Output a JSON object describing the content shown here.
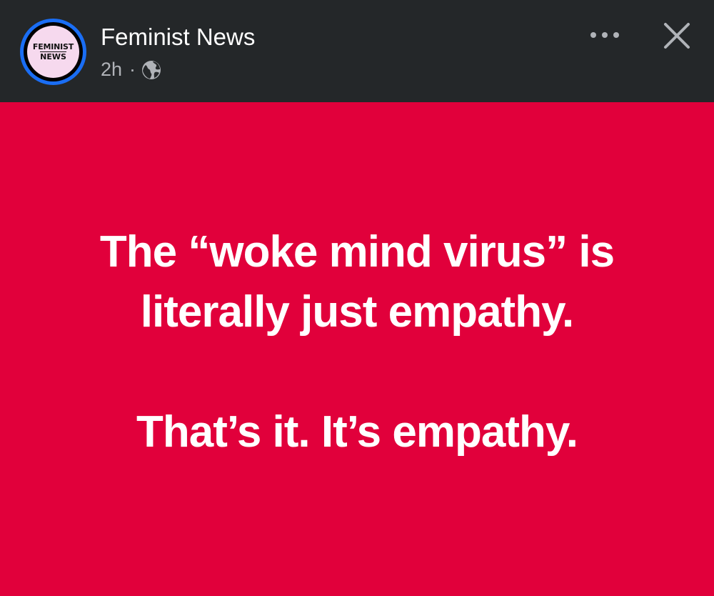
{
  "header": {
    "page_name": "Feminist News",
    "time_ago": "2h",
    "separator": "·",
    "audience_icon": "globe-icon",
    "avatar": {
      "line1": "FEMINIST",
      "line2": "NEWS"
    },
    "more_icon": "ellipsis-icon",
    "close_icon": "close-icon"
  },
  "post": {
    "background_color": "#e1003b",
    "lines": [
      "The “woke mind virus” is",
      "literally just empathy.",
      "That’s it. It’s empathy."
    ]
  },
  "colors": {
    "header_bg": "#242729",
    "avatar_ring": "#1a6ef5",
    "text_primary": "#ffffff",
    "text_secondary": "#b0b3b8"
  }
}
